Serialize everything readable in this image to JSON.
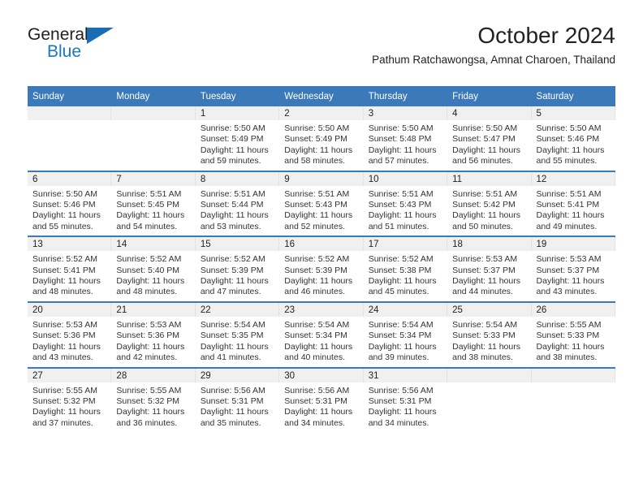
{
  "brand": {
    "name_part1": "General",
    "name_part2": "Blue",
    "triangle_icon": "triangle-icon",
    "colors": {
      "dark_text": "#231f20",
      "blue_text": "#1878be",
      "triangle": "#1b6db3"
    }
  },
  "header": {
    "title": "October 2024",
    "subtitle": "Pathum Ratchawongsa, Amnat Charoen, Thailand"
  },
  "theme": {
    "header_blue": "#3b79b8",
    "day_band_gray": "#f0f0f0",
    "week_divider": "#3b79b8"
  },
  "weekday_headers": [
    "Sunday",
    "Monday",
    "Tuesday",
    "Wednesday",
    "Thursday",
    "Friday",
    "Saturday"
  ],
  "weeks": [
    [
      {
        "day": "",
        "sunrise": "",
        "sunset": "",
        "daylight1": "",
        "daylight2": ""
      },
      {
        "day": "",
        "sunrise": "",
        "sunset": "",
        "daylight1": "",
        "daylight2": ""
      },
      {
        "day": "1",
        "sunrise": "Sunrise: 5:50 AM",
        "sunset": "Sunset: 5:49 PM",
        "daylight1": "Daylight: 11 hours",
        "daylight2": "and 59 minutes."
      },
      {
        "day": "2",
        "sunrise": "Sunrise: 5:50 AM",
        "sunset": "Sunset: 5:49 PM",
        "daylight1": "Daylight: 11 hours",
        "daylight2": "and 58 minutes."
      },
      {
        "day": "3",
        "sunrise": "Sunrise: 5:50 AM",
        "sunset": "Sunset: 5:48 PM",
        "daylight1": "Daylight: 11 hours",
        "daylight2": "and 57 minutes."
      },
      {
        "day": "4",
        "sunrise": "Sunrise: 5:50 AM",
        "sunset": "Sunset: 5:47 PM",
        "daylight1": "Daylight: 11 hours",
        "daylight2": "and 56 minutes."
      },
      {
        "day": "5",
        "sunrise": "Sunrise: 5:50 AM",
        "sunset": "Sunset: 5:46 PM",
        "daylight1": "Daylight: 11 hours",
        "daylight2": "and 55 minutes."
      }
    ],
    [
      {
        "day": "6",
        "sunrise": "Sunrise: 5:50 AM",
        "sunset": "Sunset: 5:46 PM",
        "daylight1": "Daylight: 11 hours",
        "daylight2": "and 55 minutes."
      },
      {
        "day": "7",
        "sunrise": "Sunrise: 5:51 AM",
        "sunset": "Sunset: 5:45 PM",
        "daylight1": "Daylight: 11 hours",
        "daylight2": "and 54 minutes."
      },
      {
        "day": "8",
        "sunrise": "Sunrise: 5:51 AM",
        "sunset": "Sunset: 5:44 PM",
        "daylight1": "Daylight: 11 hours",
        "daylight2": "and 53 minutes."
      },
      {
        "day": "9",
        "sunrise": "Sunrise: 5:51 AM",
        "sunset": "Sunset: 5:43 PM",
        "daylight1": "Daylight: 11 hours",
        "daylight2": "and 52 minutes."
      },
      {
        "day": "10",
        "sunrise": "Sunrise: 5:51 AM",
        "sunset": "Sunset: 5:43 PM",
        "daylight1": "Daylight: 11 hours",
        "daylight2": "and 51 minutes."
      },
      {
        "day": "11",
        "sunrise": "Sunrise: 5:51 AM",
        "sunset": "Sunset: 5:42 PM",
        "daylight1": "Daylight: 11 hours",
        "daylight2": "and 50 minutes."
      },
      {
        "day": "12",
        "sunrise": "Sunrise: 5:51 AM",
        "sunset": "Sunset: 5:41 PM",
        "daylight1": "Daylight: 11 hours",
        "daylight2": "and 49 minutes."
      }
    ],
    [
      {
        "day": "13",
        "sunrise": "Sunrise: 5:52 AM",
        "sunset": "Sunset: 5:41 PM",
        "daylight1": "Daylight: 11 hours",
        "daylight2": "and 48 minutes."
      },
      {
        "day": "14",
        "sunrise": "Sunrise: 5:52 AM",
        "sunset": "Sunset: 5:40 PM",
        "daylight1": "Daylight: 11 hours",
        "daylight2": "and 48 minutes."
      },
      {
        "day": "15",
        "sunrise": "Sunrise: 5:52 AM",
        "sunset": "Sunset: 5:39 PM",
        "daylight1": "Daylight: 11 hours",
        "daylight2": "and 47 minutes."
      },
      {
        "day": "16",
        "sunrise": "Sunrise: 5:52 AM",
        "sunset": "Sunset: 5:39 PM",
        "daylight1": "Daylight: 11 hours",
        "daylight2": "and 46 minutes."
      },
      {
        "day": "17",
        "sunrise": "Sunrise: 5:52 AM",
        "sunset": "Sunset: 5:38 PM",
        "daylight1": "Daylight: 11 hours",
        "daylight2": "and 45 minutes."
      },
      {
        "day": "18",
        "sunrise": "Sunrise: 5:53 AM",
        "sunset": "Sunset: 5:37 PM",
        "daylight1": "Daylight: 11 hours",
        "daylight2": "and 44 minutes."
      },
      {
        "day": "19",
        "sunrise": "Sunrise: 5:53 AM",
        "sunset": "Sunset: 5:37 PM",
        "daylight1": "Daylight: 11 hours",
        "daylight2": "and 43 minutes."
      }
    ],
    [
      {
        "day": "20",
        "sunrise": "Sunrise: 5:53 AM",
        "sunset": "Sunset: 5:36 PM",
        "daylight1": "Daylight: 11 hours",
        "daylight2": "and 43 minutes."
      },
      {
        "day": "21",
        "sunrise": "Sunrise: 5:53 AM",
        "sunset": "Sunset: 5:36 PM",
        "daylight1": "Daylight: 11 hours",
        "daylight2": "and 42 minutes."
      },
      {
        "day": "22",
        "sunrise": "Sunrise: 5:54 AM",
        "sunset": "Sunset: 5:35 PM",
        "daylight1": "Daylight: 11 hours",
        "daylight2": "and 41 minutes."
      },
      {
        "day": "23",
        "sunrise": "Sunrise: 5:54 AM",
        "sunset": "Sunset: 5:34 PM",
        "daylight1": "Daylight: 11 hours",
        "daylight2": "and 40 minutes."
      },
      {
        "day": "24",
        "sunrise": "Sunrise: 5:54 AM",
        "sunset": "Sunset: 5:34 PM",
        "daylight1": "Daylight: 11 hours",
        "daylight2": "and 39 minutes."
      },
      {
        "day": "25",
        "sunrise": "Sunrise: 5:54 AM",
        "sunset": "Sunset: 5:33 PM",
        "daylight1": "Daylight: 11 hours",
        "daylight2": "and 38 minutes."
      },
      {
        "day": "26",
        "sunrise": "Sunrise: 5:55 AM",
        "sunset": "Sunset: 5:33 PM",
        "daylight1": "Daylight: 11 hours",
        "daylight2": "and 38 minutes."
      }
    ],
    [
      {
        "day": "27",
        "sunrise": "Sunrise: 5:55 AM",
        "sunset": "Sunset: 5:32 PM",
        "daylight1": "Daylight: 11 hours",
        "daylight2": "and 37 minutes."
      },
      {
        "day": "28",
        "sunrise": "Sunrise: 5:55 AM",
        "sunset": "Sunset: 5:32 PM",
        "daylight1": "Daylight: 11 hours",
        "daylight2": "and 36 minutes."
      },
      {
        "day": "29",
        "sunrise": "Sunrise: 5:56 AM",
        "sunset": "Sunset: 5:31 PM",
        "daylight1": "Daylight: 11 hours",
        "daylight2": "and 35 minutes."
      },
      {
        "day": "30",
        "sunrise": "Sunrise: 5:56 AM",
        "sunset": "Sunset: 5:31 PM",
        "daylight1": "Daylight: 11 hours",
        "daylight2": "and 34 minutes."
      },
      {
        "day": "31",
        "sunrise": "Sunrise: 5:56 AM",
        "sunset": "Sunset: 5:31 PM",
        "daylight1": "Daylight: 11 hours",
        "daylight2": "and 34 minutes."
      },
      {
        "day": "",
        "sunrise": "",
        "sunset": "",
        "daylight1": "",
        "daylight2": ""
      },
      {
        "day": "",
        "sunrise": "",
        "sunset": "",
        "daylight1": "",
        "daylight2": ""
      }
    ]
  ]
}
